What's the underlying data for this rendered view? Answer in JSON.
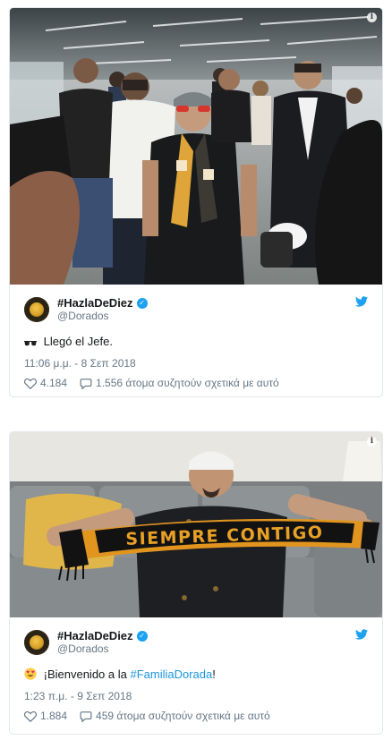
{
  "tweets": [
    {
      "display_name": "#HazlaDeDiez",
      "handle": "@Dorados",
      "emoji_icon": "sunglasses-emoji",
      "text": "Llegó el Jefe.",
      "timestamp": "11:06 μ.μ. - 8 Σεπ 2018",
      "likes": "4.184",
      "discussion": "1.556 άτομα συζητούν σχετικά με αυτό"
    },
    {
      "display_name": "#HazlaDeDiez",
      "handle": "@Dorados",
      "emoji_icon": "heart-eyes-emoji",
      "text_before": "¡Bienvenido a la ",
      "hashtag": "#FamiliaDorada",
      "text_after": "!",
      "timestamp": "1:23 π.μ. - 9 Σεπ 2018",
      "likes": "1.884",
      "discussion": "459 άτομα συζητούν σχετικά με αυτό",
      "scarf_text": "SIEMPRE CONTIGO"
    }
  ],
  "info_symbol": "i",
  "verified_symbol": "✓",
  "colors": {
    "link": "#1b95e0",
    "twitter_blue": "#1da1f2",
    "muted": "#657786",
    "dorados_gold": "#d9a22a"
  }
}
